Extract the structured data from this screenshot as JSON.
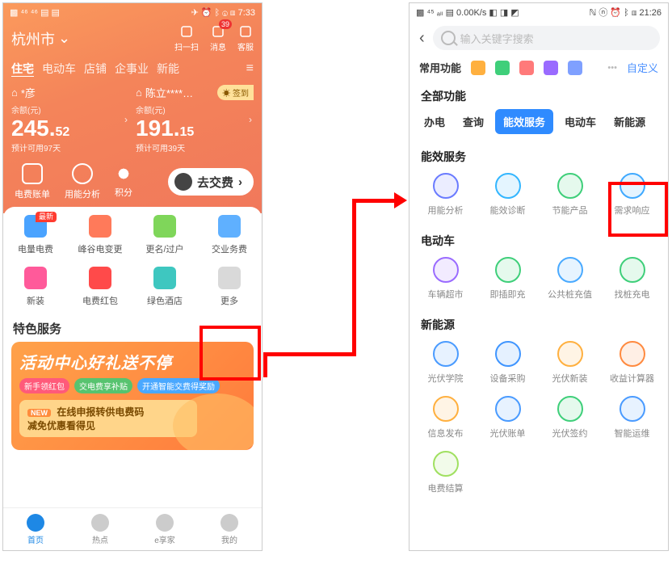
{
  "left": {
    "status": {
      "left_icons": "▩ ⁴⁶ ⁴⁶ ▤ ▤",
      "right": "✈ ⏰ ᛒ ⓘ ▥ 7:33"
    },
    "city": "杭州市",
    "hero_actions": [
      {
        "label": "扫一扫"
      },
      {
        "label": "消息",
        "badge": "39"
      },
      {
        "label": "客服"
      }
    ],
    "tabs": [
      "住宅",
      "电动车",
      "店铺",
      "企事业",
      "新能"
    ],
    "cards": [
      {
        "name": "*彦",
        "bal_label": "余额(元)",
        "bal_int": "245.",
        "bal_dec": "52",
        "est": "预计可用97天"
      },
      {
        "name": "陈立****…",
        "bal_label": "余额(元)",
        "bal_int": "191.",
        "bal_dec": "15",
        "est": "预计可用39天",
        "sign": "签到"
      }
    ],
    "quick": [
      "电费账单",
      "用能分析",
      "积分"
    ],
    "pay": "去交费",
    "grid": [
      {
        "label": "电量电费",
        "color": "#4aa3ff",
        "tag": "最新"
      },
      {
        "label": "峰谷电变更",
        "color": "#ff7a5a"
      },
      {
        "label": "更名/过户",
        "color": "#7fd65a"
      },
      {
        "label": "交业务费",
        "color": "#5fb0ff"
      },
      {
        "label": "新装",
        "color": "#ff5a9a"
      },
      {
        "label": "电费红包",
        "color": "#ff4a4a"
      },
      {
        "label": "绿色酒店",
        "color": "#3ec7c0"
      },
      {
        "label": "更多",
        "color": "#d9d9d9"
      }
    ],
    "special_header": "特色服务",
    "promo": {
      "title": "活动中心好礼送不停",
      "chips": [
        "新手领红包",
        "交电费享补贴",
        "开通智能交费得奖励"
      ],
      "sub_new": "NEW",
      "sub_l1": "在线申报转供电费码",
      "sub_l2": "减免优惠看得见"
    },
    "nav": [
      "首页",
      "热点",
      "e享家",
      "我的"
    ]
  },
  "right": {
    "status": {
      "left": "▩ ⁴⁵ ₐₗₗ ▤ 0.00K/s ◧ ◨ ◩",
      "right": "ℕ ⓝ ⏰ ᛒ ▥ 21:26"
    },
    "search_placeholder": "输入关键字搜索",
    "fav_label": "常用功能",
    "fav_more": "•••",
    "fav_custom": "自定义",
    "all_header": "全部功能",
    "cats": [
      "办电",
      "查询",
      "能效服务",
      "电动车",
      "新能源"
    ],
    "active_cat_index": 2,
    "sections": [
      {
        "title": "能效服务",
        "items": [
          {
            "label": "用能分析",
            "c": "#6a7bff"
          },
          {
            "label": "能效诊断",
            "c": "#33b6ff"
          },
          {
            "label": "节能产品",
            "c": "#3fcf7a"
          },
          {
            "label": "需求响应",
            "c": "#3fa9ff"
          }
        ]
      },
      {
        "title": "电动车",
        "items": [
          {
            "label": "车辆超市",
            "c": "#9a6bff"
          },
          {
            "label": "即插即充",
            "c": "#3fcf7a"
          },
          {
            "label": "公共桩充值",
            "c": "#4aaaff"
          },
          {
            "label": "找桩充电",
            "c": "#3fcf7a"
          }
        ]
      },
      {
        "title": "新能源",
        "items": [
          {
            "label": "光伏学院",
            "c": "#4a9bff"
          },
          {
            "label": "设备采购",
            "c": "#3f95ff"
          },
          {
            "label": "光伏新装",
            "c": "#ffb03f"
          },
          {
            "label": "收益计算器",
            "c": "#ff8a3f"
          },
          {
            "label": "信息发布",
            "c": "#ffb03f"
          },
          {
            "label": "光伏账单",
            "c": "#4a9bff"
          },
          {
            "label": "光伏签约",
            "c": "#3fcf7a"
          },
          {
            "label": "智能运维",
            "c": "#4a9bff"
          },
          {
            "label": "电费结算",
            "c": "#a0e060"
          }
        ]
      }
    ]
  }
}
